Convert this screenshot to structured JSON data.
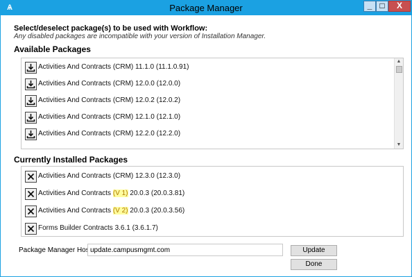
{
  "window": {
    "title": "Package Manager",
    "app_icon_glyph": "Ѧ",
    "controls": {
      "minimize": "_",
      "maximize": "□",
      "close": "X"
    }
  },
  "intro": {
    "heading": "Select/deselect package(s) to be used with Workflow:",
    "note": "Any disabled packages are incompatible with your version of Installation Manager."
  },
  "available": {
    "title": "Available Packages",
    "action_icon": "download-icon",
    "items": [
      {
        "name": "Activities And Contracts (CRM) 11.1.0 (11.1.0.91)"
      },
      {
        "name": "Activities And Contracts (CRM) 12.0.0 (12.0.0)"
      },
      {
        "name": "Activities And Contracts (CRM) 12.0.2 (12.0.2)"
      },
      {
        "name": "Activities And Contracts (CRM) 12.1.0 (12.1.0)"
      },
      {
        "name": "Activities And Contracts (CRM) 12.2.0 (12.2.0)"
      }
    ]
  },
  "installed": {
    "title": "Currently Installed Packages",
    "action_icon": "close-x-icon",
    "items": [
      {
        "pre": "Activities And Contracts (CRM) 12.3.0 (12.3.0)",
        "hl": "",
        "post": ""
      },
      {
        "pre": "Activities And Contracts ",
        "hl": "(V 1)",
        "post": " 20.0.3 (20.0.3.81)"
      },
      {
        "pre": "Activities And Contracts ",
        "hl": "(V 2)",
        "post": " 20.0.3 (20.0.3.56)"
      },
      {
        "pre": "Forms Builder Contracts 3.6.1 (3.6.1.7)",
        "hl": "",
        "post": ""
      }
    ]
  },
  "footer": {
    "host_label": "Package Manager Host:",
    "host_value": "update.campusmgmt.com",
    "update_label": "Update",
    "done_label": "Done"
  },
  "colors": {
    "titlebar": "#1ba1e2",
    "close_button": "#c75050",
    "highlight_bg": "#fffd9e",
    "highlight_text": "#b07a00"
  }
}
